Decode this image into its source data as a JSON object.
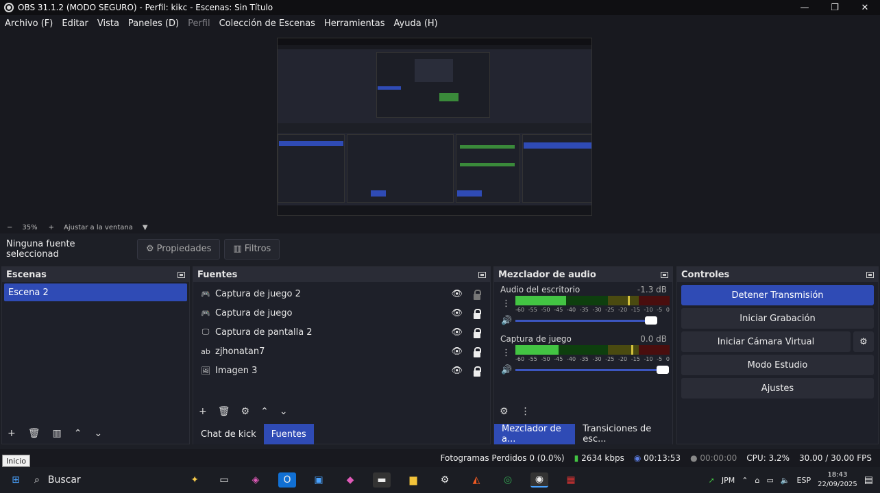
{
  "window": {
    "title": "OBS 31.1.2 (MODO SEGURO) - Perfil: kikc - Escenas: Sin Título",
    "controls": [
      "—",
      "❐",
      "✕"
    ]
  },
  "menu": [
    {
      "label": "Archivo (F)",
      "disabled": false
    },
    {
      "label": "Editar",
      "disabled": false
    },
    {
      "label": "Vista",
      "disabled": false
    },
    {
      "label": "Paneles (D)",
      "disabled": false
    },
    {
      "label": "Perfil",
      "disabled": true
    },
    {
      "label": "Colección de Escenas",
      "disabled": false
    },
    {
      "label": "Herramientas",
      "disabled": false
    },
    {
      "label": "Ayuda (H)",
      "disabled": false
    }
  ],
  "zoom": {
    "minus": "−",
    "value": "35%",
    "plus": "+",
    "fit": "Ajustar a la ventana",
    "caret": "▼"
  },
  "source_bar": {
    "none_selected": "Ninguna fuente seleccionad",
    "properties": "Propiedades",
    "filters": "Filtros"
  },
  "scenes": {
    "title": "Escenas",
    "items": [
      "Escena 2"
    ]
  },
  "sources": {
    "title": "Fuentes",
    "items": [
      {
        "icon": "gamepad-icon",
        "glyph": "🎮",
        "label": "Captura de juego 2",
        "locked": false
      },
      {
        "icon": "gamepad-icon",
        "glyph": "🎮",
        "label": "Captura de juego",
        "locked": true
      },
      {
        "icon": "monitor-icon",
        "glyph": "🖵",
        "label": "Captura de pantalla 2",
        "locked": true
      },
      {
        "icon": "text-icon",
        "glyph": "ab",
        "label": "zjhonatan7",
        "locked": true
      },
      {
        "icon": "image-icon",
        "glyph": "🖼",
        "label": "Imagen 3",
        "locked": true
      }
    ],
    "tabs": [
      "Chat de kick",
      "Fuentes"
    ]
  },
  "mixer": {
    "title": "Mezclador de audio",
    "channels": [
      {
        "name": "Audio del escritorio",
        "db": "-1.3 dB",
        "level": 0.33,
        "peak": 0.73,
        "volume": 0.92
      },
      {
        "name": "Captura de juego",
        "db": "0.0 dB",
        "level": 0.28,
        "peak": 0.75,
        "volume": 1.0
      }
    ],
    "ticks": [
      "-60",
      "-55",
      "-50",
      "-45",
      "-40",
      "-35",
      "-30",
      "-25",
      "-20",
      "-15",
      "-10",
      "-5",
      "0"
    ],
    "tabs": [
      "Mezclador de a...",
      "Transiciones de esc..."
    ]
  },
  "controls": {
    "title": "Controles",
    "buttons": [
      "Detener Transmisión",
      "Iniciar Grabación",
      "Iniciar Cámara Virtual",
      "Modo Estudio",
      "Ajustes"
    ]
  },
  "status": {
    "dropped": "Fotogramas Perdidos 0 (0.0%)",
    "kbps": "2634 kbps",
    "stream_time": "00:13:53",
    "rec_time": "00:00:00",
    "cpu": "CPU: 3.2%",
    "fps": "30.00 / 30.00 FPS"
  },
  "tooltip": "Inicio",
  "taskbar": {
    "search": "Buscar",
    "lang_badge": "JPM",
    "lang": "ESP",
    "time": "18:43",
    "date": "22/09/2025"
  },
  "colors": {
    "accent": "#2f4bb5",
    "bg": "#1d1f26",
    "panel": "#1e2029"
  }
}
